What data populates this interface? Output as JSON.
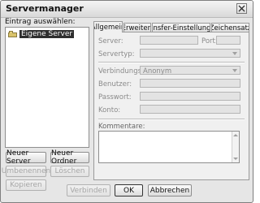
{
  "window": {
    "title": "Servermanager",
    "close_icon": "close-icon"
  },
  "left": {
    "entry_label": "Eintrag auswählen:",
    "tree_item": "Eigene Server",
    "buttons": {
      "new_server": "Neuer Server",
      "new_folder": "Neuer Ordner",
      "rename": "Umbenennen",
      "delete": "Löschen",
      "copy": "Kopieren"
    }
  },
  "tabs": [
    {
      "label": "Allgemein"
    },
    {
      "label": "Erweitert"
    },
    {
      "label": "Transfer-Einstellungen"
    },
    {
      "label": "Zeichensatz"
    }
  ],
  "general": {
    "server_label": "Server:",
    "port_label": "Port:",
    "servertype_label": "Servertyp:",
    "connection_label": "Verbindungsart:",
    "connection_value": "Anonym",
    "user_label": "Benutzer:",
    "password_label": "Passwort:",
    "account_label": "Konto:",
    "comments_label": "Kommentare:"
  },
  "bottom": {
    "connect": "Verbinden",
    "ok": "OK",
    "cancel": "Abbrechen"
  }
}
